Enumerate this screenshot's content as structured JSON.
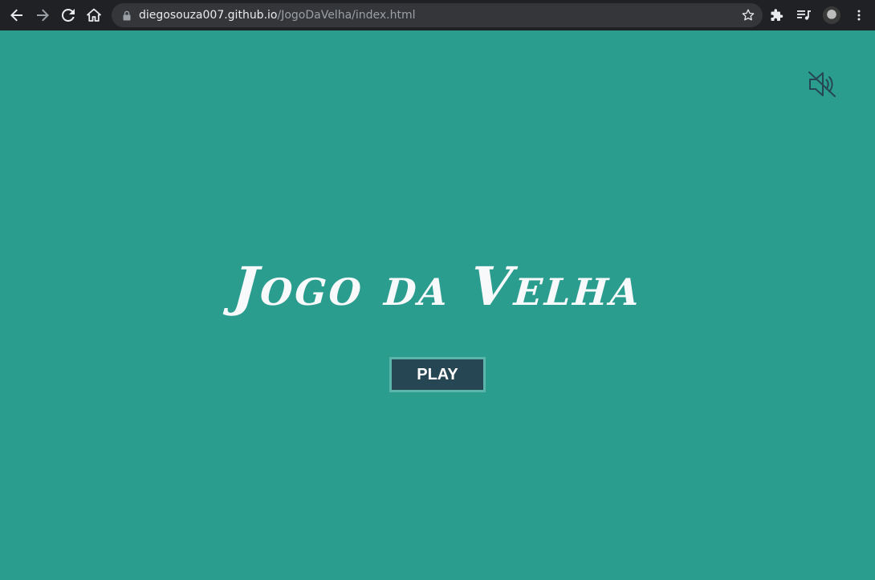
{
  "browser": {
    "url_host": "diegosouza007.github.io",
    "url_path": "/JogoDaVelha/index.html"
  },
  "page": {
    "title": "Jogo da Velha",
    "play_label": "PLAY",
    "sound_state": "muted"
  },
  "colors": {
    "background": "#2a9d8f",
    "button_bg": "#264653",
    "button_border": "#5ab5aa",
    "title": "#f8f9fa"
  }
}
